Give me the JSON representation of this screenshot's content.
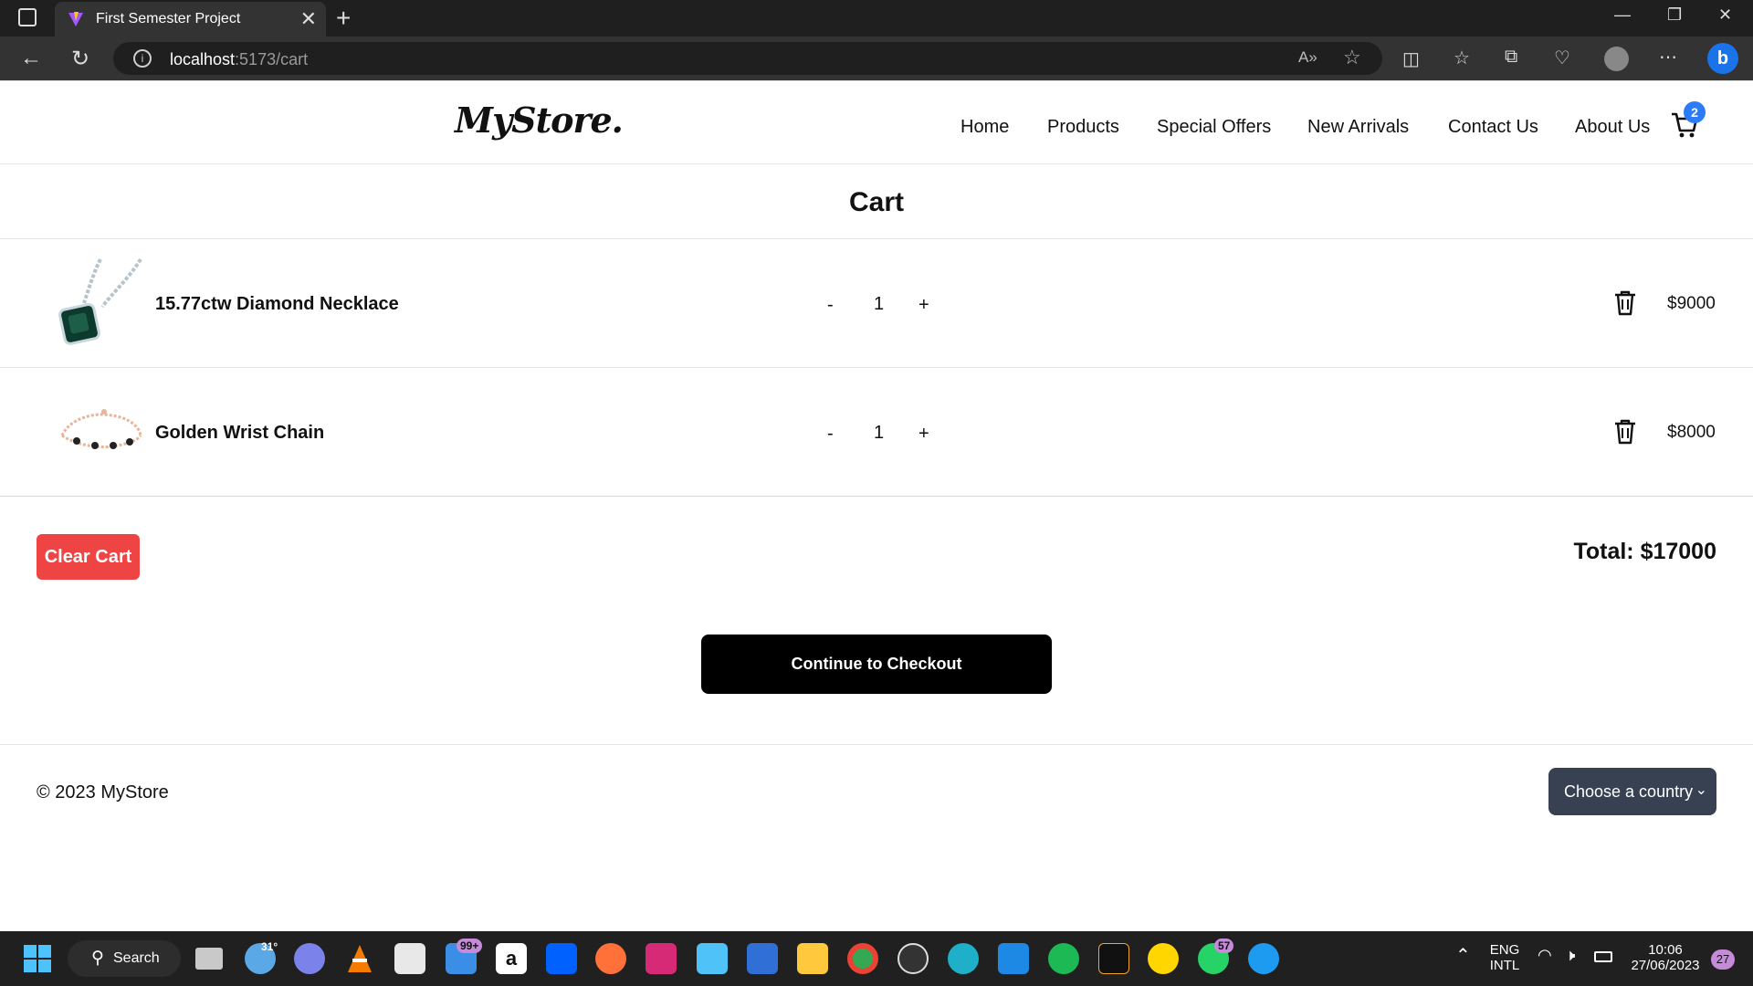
{
  "browser": {
    "tab_title": "First Semester Project",
    "url_host": "localhost",
    "url_path": ":5173/cart"
  },
  "site": {
    "logo": "MyStore.",
    "nav": [
      "Home",
      "Products",
      "Special Offers",
      "New Arrivals",
      "Contact Us",
      "About Us"
    ],
    "cart_count": "2"
  },
  "cart": {
    "title": "Cart",
    "items": [
      {
        "name": "15.77ctw Diamond Necklace",
        "minus": "-",
        "qty": "1",
        "plus": "+",
        "price": "$9000",
        "thumb_icon": "necklace-image"
      },
      {
        "name": "Golden Wrist Chain",
        "minus": "-",
        "qty": "1",
        "plus": "+",
        "price": "$8000",
        "thumb_icon": "bracelet-image"
      }
    ],
    "clear_label": "Clear Cart",
    "total": "Total: $17000",
    "checkout_label": "Continue to Checkout"
  },
  "footer": {
    "copyright": "© 2023 MyStore",
    "country_select": "Choose a country"
  },
  "taskbar": {
    "search_label": "Search",
    "weather": "31°",
    "mail_badge": "99+",
    "whatsapp_badge": "57",
    "lang_top": "ENG",
    "lang_bottom": "INTL",
    "time": "10:06",
    "date": "27/06/2023",
    "notif_count": "27"
  },
  "colors": {
    "accent_blue": "#2b7cf6",
    "clear_red": "#ef4444",
    "select_bg": "#374151"
  }
}
